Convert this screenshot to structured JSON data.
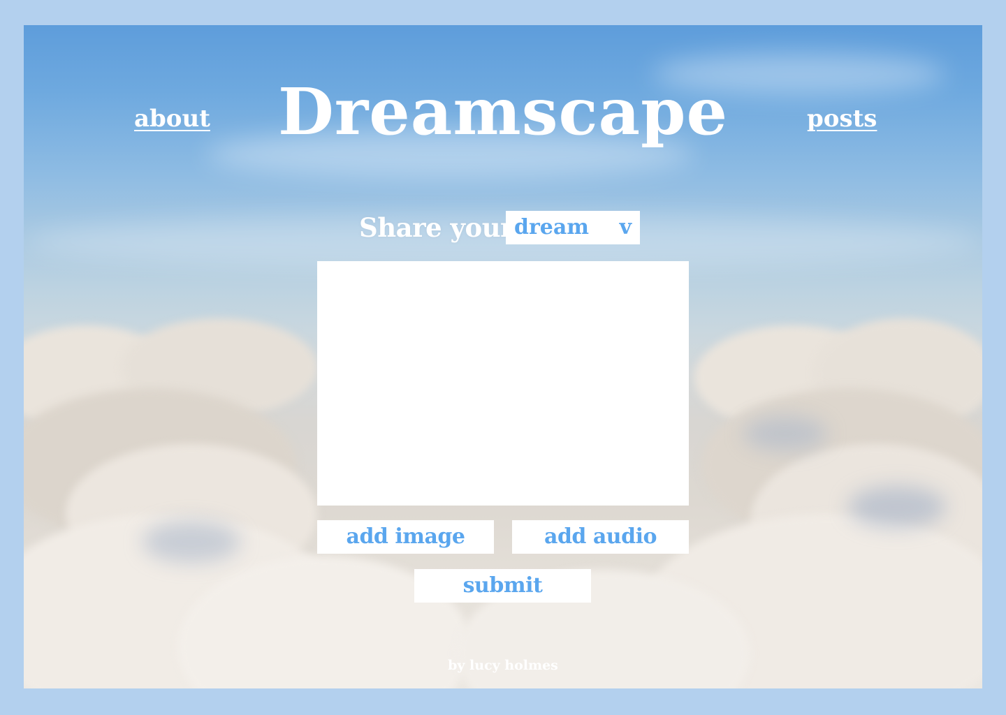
{
  "header": {
    "title": "Dreamscape",
    "about_label": "about",
    "posts_label": "posts"
  },
  "form": {
    "share_label": "Share your",
    "type_select": {
      "value": "dream",
      "caret": "v"
    },
    "text_value": "",
    "add_image_label": "add image",
    "add_audio_label": "add audio",
    "submit_label": "submit"
  },
  "footer": {
    "credit": "by lucy holmes"
  },
  "colors": {
    "page_border": "#b3d0ee",
    "sky_top": "#5e9ddb",
    "accent_text": "#5aa6ee",
    "white": "#ffffff"
  }
}
